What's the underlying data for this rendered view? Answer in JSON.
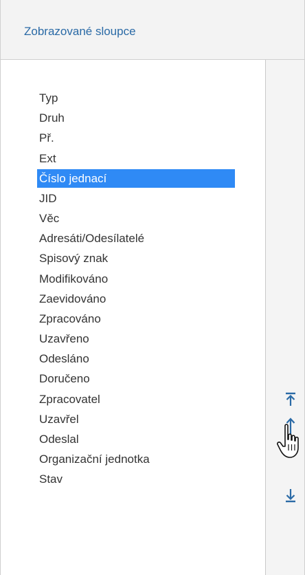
{
  "header": {
    "title": "Zobrazované sloupce"
  },
  "columns": {
    "items": [
      {
        "label": "Typ",
        "selected": false
      },
      {
        "label": "Druh",
        "selected": false
      },
      {
        "label": "Př.",
        "selected": false
      },
      {
        "label": "Ext",
        "selected": false
      },
      {
        "label": "Číslo jednací",
        "selected": true
      },
      {
        "label": "JID",
        "selected": false
      },
      {
        "label": "Věc",
        "selected": false
      },
      {
        "label": "Adresáti/Odesílatelé",
        "selected": false
      },
      {
        "label": "Spisový znak",
        "selected": false
      },
      {
        "label": "Modifikováno",
        "selected": false
      },
      {
        "label": "Zaevidováno",
        "selected": false
      },
      {
        "label": "Zpracováno",
        "selected": false
      },
      {
        "label": "Uzavřeno",
        "selected": false
      },
      {
        "label": "Odesláno",
        "selected": false
      },
      {
        "label": "Doručeno",
        "selected": false
      },
      {
        "label": "Zpracovatel",
        "selected": false
      },
      {
        "label": "Uzavřel",
        "selected": false
      },
      {
        "label": "Odeslal",
        "selected": false
      },
      {
        "label": "Organizační jednotka",
        "selected": false
      },
      {
        "label": "Stav",
        "selected": false
      }
    ]
  },
  "tools": {
    "move_top_icon": "move-to-top-icon",
    "move_up_down_icon": "move-up-down-icon",
    "move_bottom_icon": "move-to-bottom-icon"
  },
  "colors": {
    "accent": "#2f8af5",
    "title": "#2a6aa6",
    "icon": "#2a6aa6"
  }
}
